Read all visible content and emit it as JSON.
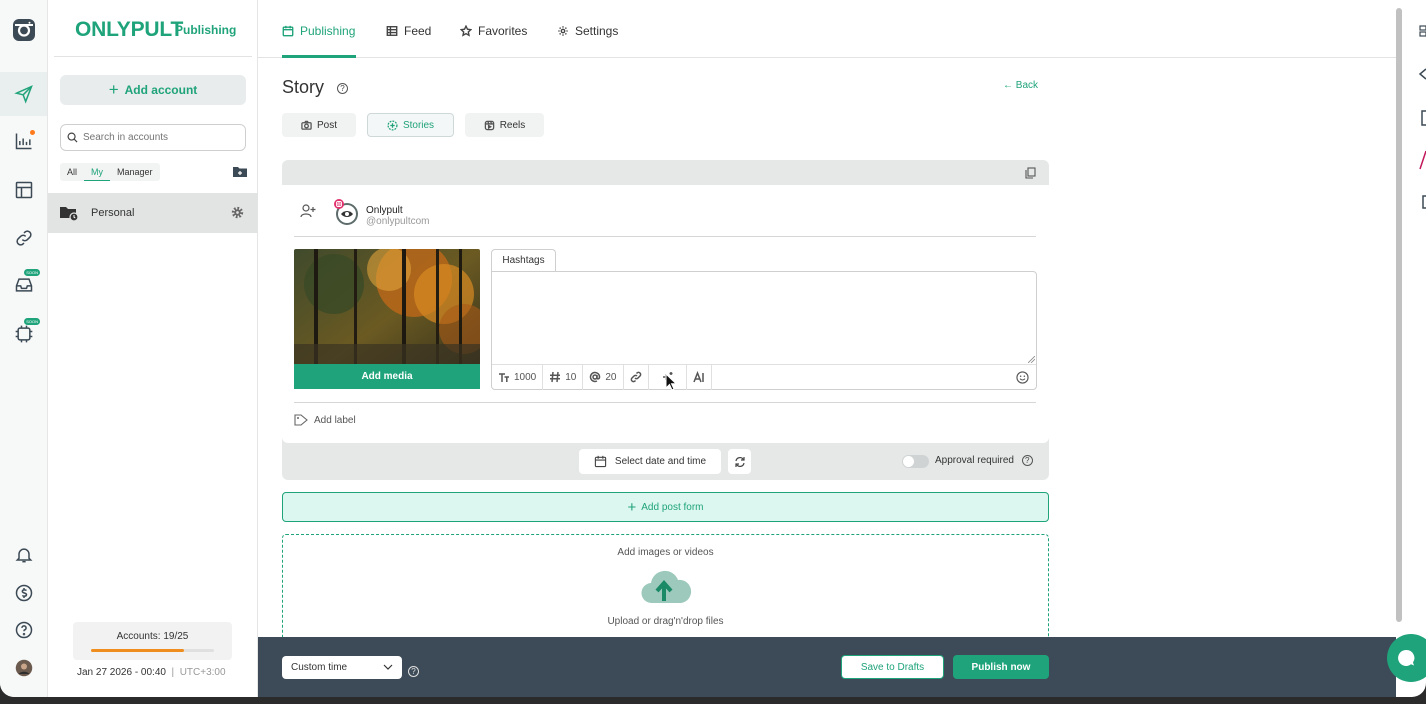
{
  "brand": {
    "name": "ONLYPULT",
    "section": "Publishing",
    "accent": "#1fa37a"
  },
  "sidebar": {
    "icons": [
      "instagram-icon",
      "send-icon",
      "analytics-icon",
      "layout-icon",
      "link-icon",
      "inbox-icon",
      "ai-icon",
      "bell-icon",
      "dollar-icon",
      "help-icon",
      "avatar"
    ],
    "soon_badge": "SOON"
  },
  "accounts_panel": {
    "add_account": "Add account",
    "search_placeholder": "Search in accounts",
    "filters": [
      "All",
      "My",
      "Manager"
    ],
    "selected_filter": "My",
    "groups": [
      {
        "label": "Personal"
      }
    ],
    "accounts_count": "Accounts: 19/25",
    "accounts_progress": 0.76,
    "datetime": "Jan 27 2026 - 00:40",
    "timezone": "UTC+3:00"
  },
  "topnav": {
    "tabs": [
      "Publishing",
      "Feed",
      "Favorites",
      "Settings"
    ],
    "active": "Publishing"
  },
  "page": {
    "title": "Story",
    "back": "Back",
    "post_types": [
      "Post",
      "Stories",
      "Reels"
    ],
    "active_post_type": "Stories"
  },
  "post_form": {
    "account_name": "Onlypult",
    "account_handle": "@onlypultcom",
    "add_media": "Add media",
    "text_tab": "Hashtags",
    "text_value": "",
    "counters": {
      "chars": "1000",
      "hashtags": "10",
      "mentions": "20"
    },
    "add_label": "Add label",
    "select_date": "Select date and time",
    "approval": "Approval required",
    "approval_on": false
  },
  "add_post_form": "Add post form",
  "dropzone": {
    "title": "Add images or videos",
    "hint": "Upload or drag'n'drop files"
  },
  "bottom": {
    "time_mode": "Custom time",
    "save_drafts": "Save to Drafts",
    "publish_now": "Publish now"
  }
}
